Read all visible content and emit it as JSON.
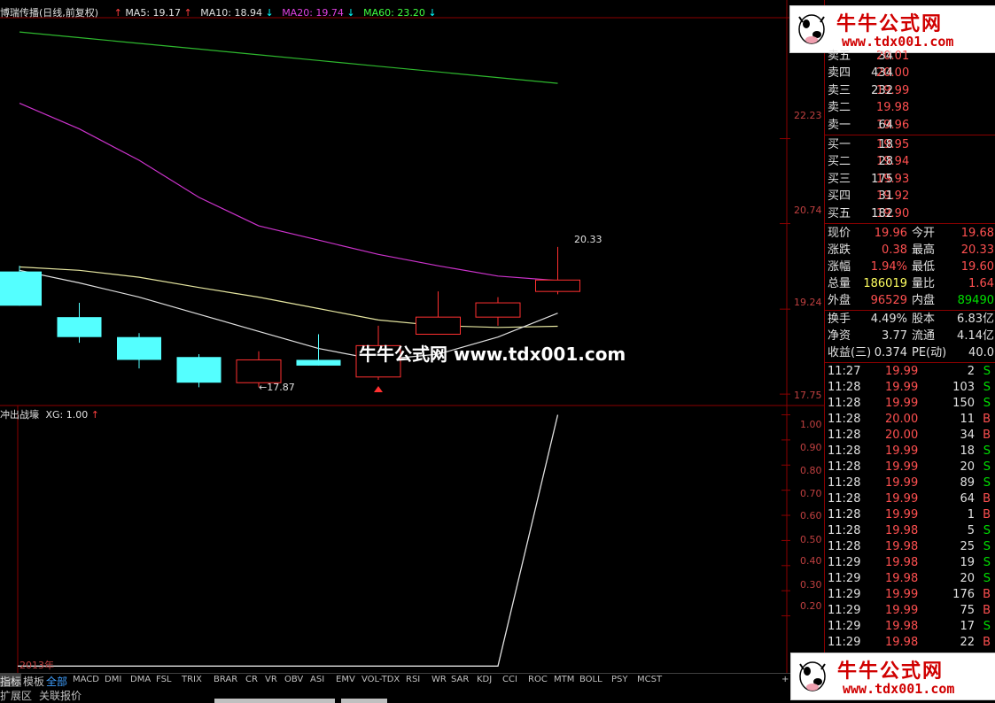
{
  "header": {
    "title": "博瑞传播(日线,前复权)",
    "ma5": "MA5: 19.17",
    "ma10": "MA10: 18.94",
    "ma20": "MA20: 19.74",
    "ma60": "MA60: 23.20",
    "ma5_arrow": "↑",
    "ma10_arrow": "↓",
    "ma20_arrow": "↓",
    "ma60_arrow": "↓",
    "ma5_color": "#ff4040",
    "ma10_color": "#e0e0e0",
    "ma20_color": "#e040e0",
    "ma60_color": "#40ff40"
  },
  "price_axis": {
    "labels": [
      "22.23",
      "20.74",
      "19.24",
      "17.75"
    ]
  },
  "indicator_axis": {
    "labels": [
      "1.00",
      "0.90",
      "0.80",
      "0.70",
      "0.60",
      "0.50",
      "0.40",
      "0.30",
      "0.20"
    ]
  },
  "annotations": {
    "high": "20.33",
    "low": "←17.87"
  },
  "indicator": {
    "name": "冲出战壕",
    "value": "XG: 1.00",
    "arrow": "↑"
  },
  "year_label": "2013年",
  "watermark": "牛牛公式网 www.tdx001.com",
  "logo": {
    "title": "牛牛公式网",
    "url": "www.tdx001.com"
  },
  "chart_data": {
    "type": "candlestick",
    "candles": [
      {
        "open": 19.9,
        "close": 19.3,
        "high": 20.0,
        "low": 19.3,
        "up": false
      },
      {
        "open": 19.1,
        "close": 18.75,
        "high": 19.35,
        "low": 18.65,
        "up": false
      },
      {
        "open": 18.75,
        "close": 18.35,
        "high": 18.82,
        "low": 18.2,
        "up": false
      },
      {
        "open": 18.4,
        "close": 17.95,
        "high": 18.45,
        "low": 17.87,
        "up": false
      },
      {
        "open": 17.95,
        "close": 18.35,
        "high": 18.5,
        "low": 17.87,
        "up": true
      },
      {
        "open": 18.35,
        "close": 18.25,
        "high": 18.8,
        "low": 18.25,
        "up": false
      },
      {
        "open": 18.05,
        "close": 18.6,
        "high": 18.95,
        "low": 18.0,
        "up": true
      },
      {
        "open": 18.8,
        "close": 19.1,
        "high": 19.55,
        "low": 18.8,
        "up": true
      },
      {
        "open": 19.1,
        "close": 19.35,
        "high": 19.45,
        "low": 18.95,
        "up": true
      },
      {
        "open": 19.55,
        "close": 19.75,
        "high": 20.33,
        "low": 19.5,
        "up": true
      }
    ],
    "ma5": [
      19.92,
      19.7,
      19.45,
      19.15,
      18.85,
      18.55,
      18.35,
      18.45,
      18.75,
      19.17
    ],
    "ma10": [
      19.98,
      19.92,
      19.8,
      19.62,
      19.45,
      19.25,
      19.05,
      18.95,
      18.92,
      18.94
    ],
    "ma20": [
      22.85,
      22.4,
      21.85,
      21.2,
      20.7,
      20.45,
      20.2,
      20.0,
      19.82,
      19.74
    ],
    "ma60": [
      24.1,
      24.0,
      23.9,
      23.8,
      23.7,
      23.6,
      23.5,
      23.4,
      23.3,
      23.2
    ],
    "price_ylim": [
      17.55,
      24.35
    ],
    "indicator_values": [
      0,
      0,
      0,
      0,
      0,
      0,
      0,
      0,
      0,
      1
    ],
    "indicator_ylim": [
      -0.02,
      1.03
    ]
  },
  "orderbook": {
    "asks": [
      {
        "label": "卖五",
        "price": "20.01",
        "vol": "34"
      },
      {
        "label": "卖四",
        "price": "20.00",
        "vol": "434"
      },
      {
        "label": "卖三",
        "price": "19.99",
        "vol": "232"
      },
      {
        "label": "卖二",
        "price": "19.98",
        "vol": ""
      },
      {
        "label": "卖一",
        "price": "19.96",
        "vol": "64"
      }
    ],
    "bids": [
      {
        "label": "买一",
        "price": "19.95",
        "vol": "18"
      },
      {
        "label": "买二",
        "price": "19.94",
        "vol": "28"
      },
      {
        "label": "买三",
        "price": "19.93",
        "vol": "175"
      },
      {
        "label": "买四",
        "price": "19.92",
        "vol": "31"
      },
      {
        "label": "买五",
        "price": "19.90",
        "vol": "182"
      }
    ]
  },
  "stats": [
    {
      "l1": "现价",
      "v1": "19.96",
      "c1": "red",
      "l2": "今开",
      "v2": "19.68",
      "c2": "red"
    },
    {
      "l1": "涨跌",
      "v1": "0.38",
      "c1": "red",
      "l2": "最高",
      "v2": "20.33",
      "c2": "red"
    },
    {
      "l1": "涨幅",
      "v1": "1.94%",
      "c1": "red",
      "l2": "最低",
      "v2": "19.60",
      "c2": "red"
    },
    {
      "l1": "总量",
      "v1": "186019",
      "c1": "yel",
      "l2": "量比",
      "v2": "1.64",
      "c2": "red"
    },
    {
      "l1": "外盘",
      "v1": "96529",
      "c1": "red",
      "l2": "内盘",
      "v2": "89490",
      "c2": "grn"
    },
    {
      "l1": "换手",
      "v1": "4.49%",
      "c1": "wht",
      "l2": "股本",
      "v2": "6.83亿",
      "c2": "wht"
    },
    {
      "l1": "净资",
      "v1": "3.77",
      "c1": "wht",
      "l2": "流通",
      "v2": "4.14亿",
      "c2": "wht"
    },
    {
      "l1": "收益(三)",
      "v1": "0.374",
      "c1": "wht",
      "l2": "PE(动)",
      "v2": "40.0",
      "c2": "wht"
    }
  ],
  "ticks": [
    {
      "time": "11:27",
      "price": "19.99",
      "vol": "2",
      "side": "S"
    },
    {
      "time": "11:28",
      "price": "19.99",
      "vol": "103",
      "side": "S"
    },
    {
      "time": "11:28",
      "price": "19.99",
      "vol": "150",
      "side": "S"
    },
    {
      "time": "11:28",
      "price": "20.00",
      "vol": "11",
      "side": "B"
    },
    {
      "time": "11:28",
      "price": "20.00",
      "vol": "34",
      "side": "B"
    },
    {
      "time": "11:28",
      "price": "19.99",
      "vol": "18",
      "side": "S"
    },
    {
      "time": "11:28",
      "price": "19.99",
      "vol": "20",
      "side": "S"
    },
    {
      "time": "11:28",
      "price": "19.99",
      "vol": "89",
      "side": "S"
    },
    {
      "time": "11:28",
      "price": "19.99",
      "vol": "64",
      "side": "B"
    },
    {
      "time": "11:28",
      "price": "19.99",
      "vol": "1",
      "side": "B"
    },
    {
      "time": "11:28",
      "price": "19.98",
      "vol": "5",
      "side": "S"
    },
    {
      "time": "11:28",
      "price": "19.98",
      "vol": "25",
      "side": "S"
    },
    {
      "time": "11:29",
      "price": "19.98",
      "vol": "19",
      "side": "S"
    },
    {
      "time": "11:29",
      "price": "19.98",
      "vol": "20",
      "side": "S"
    },
    {
      "time": "11:29",
      "price": "19.99",
      "vol": "176",
      "side": "B"
    },
    {
      "time": "11:29",
      "price": "19.99",
      "vol": "75",
      "side": "B"
    },
    {
      "time": "11:29",
      "price": "19.98",
      "vol": "17",
      "side": "S"
    },
    {
      "time": "11:29",
      "price": "19.98",
      "vol": "22",
      "side": "B"
    }
  ],
  "indicator_tabs": [
    "指标",
    "模板",
    "全部",
    "MACD",
    "DMI",
    "DMA",
    "FSL",
    "TRIX",
    "BRAR",
    "CR",
    "VR",
    "OBV",
    "ASI",
    "EMV",
    "VOL-TDX",
    "RSI",
    "WR",
    "SAR",
    "KDJ",
    "CCI",
    "ROC",
    "MTM",
    "BOLL",
    "PSY",
    "MCST"
  ],
  "plus_label": "+",
  "bottom_tabs": [
    "扩展区",
    "关联报价"
  ]
}
